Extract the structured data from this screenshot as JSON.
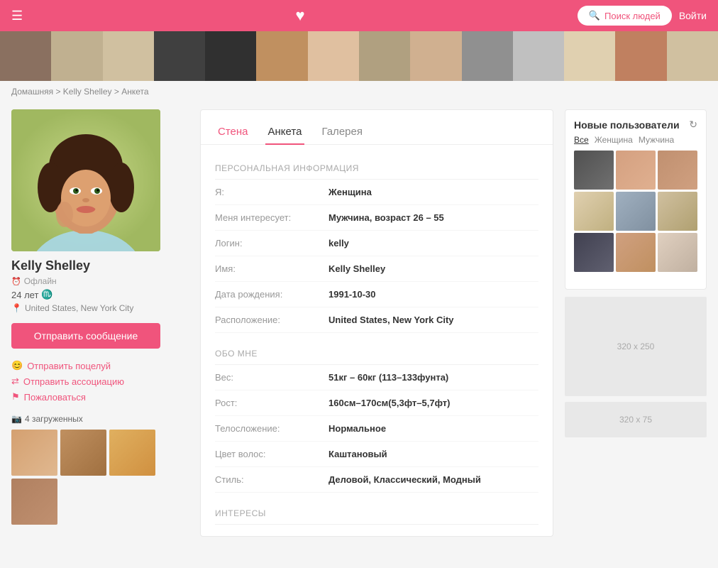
{
  "header": {
    "menu_label": "☰",
    "heart_label": "♥",
    "search_button_label": "Поиск людей",
    "login_button_label": "Войти"
  },
  "breadcrumb": {
    "home": "Домашняя",
    "separator1": " > ",
    "name": "Kelly Shelley",
    "separator2": " > ",
    "page": "Анкета"
  },
  "profile": {
    "name": "Kelly Shelley",
    "status": "Офлайн",
    "age": "24 лет",
    "zodiac": "♏",
    "location": "United States, New York City",
    "send_message_label": "Отправить сообщение",
    "photos_count_label": "4 загруженных"
  },
  "action_links": {
    "kiss": "Отправить поцелуй",
    "association": "Отправить ассоциацию",
    "report": "Пожаловаться"
  },
  "tabs": {
    "wall": "Стена",
    "profile": "Анкета",
    "gallery": "Галерея"
  },
  "personal_info": {
    "section_title": "ПЕРСОНАЛЬНАЯ ИНФОРМАЦИЯ",
    "gender_label": "Я:",
    "gender_value": "Женщина",
    "interest_label": "Меня интересует:",
    "interest_value": "Мужчина, возраст 26 – 55",
    "login_label": "Логин:",
    "login_value": "kelly",
    "name_label": "Имя:",
    "name_value": "Kelly Shelley",
    "birthday_label": "Дата рождения:",
    "birthday_value": "1991-10-30",
    "location_label": "Расположение:",
    "location_value": "United States, New York City"
  },
  "about_me": {
    "section_title": "ОБО МНЕ",
    "weight_label": "Вес:",
    "weight_value": "51кг – 60кг (113–133фунта)",
    "height_label": "Рост:",
    "height_value": "160см–170см(5,3фт–5,7фт)",
    "build_label": "Телосложение:",
    "build_value": "Нормальное",
    "hair_label": "Цвет волос:",
    "hair_value": "Каштановый",
    "style_label": "Стиль:",
    "style_value": "Деловой, Классический, Модный"
  },
  "interests": {
    "section_title": "ИНТЕРЕСЫ"
  },
  "sidebar_right": {
    "new_users_title": "Новые пользователи",
    "filter_all": "Все",
    "filter_female": "Женщина",
    "filter_male": "Мужчина",
    "ad_large_label": "320 x 250",
    "ad_small_label": "320 x 75"
  }
}
